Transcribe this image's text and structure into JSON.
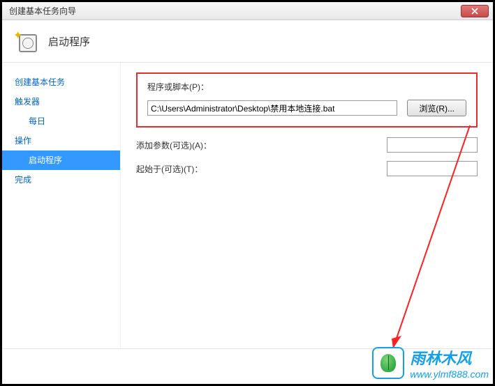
{
  "window": {
    "title": "创建基本任务向导"
  },
  "header": {
    "title": "启动程序"
  },
  "sidebar": {
    "items": [
      {
        "label": "创建基本任务"
      },
      {
        "label": "触发器"
      },
      {
        "label": "每日"
      },
      {
        "label": "操作"
      },
      {
        "label": "启动程序"
      },
      {
        "label": "完成"
      }
    ]
  },
  "form": {
    "script_label": "程序或脚本(P)：",
    "script_value": "C:\\Users\\Administrator\\Desktop\\禁用本地连接.bat",
    "browse_label": "浏览(R)...",
    "args_label": "添加参数(可选)(A)：",
    "args_value": "",
    "startin_label": "起始于(可选)(T)：",
    "startin_value": ""
  },
  "watermark": {
    "brand": "雨林木风",
    "url": "www.ylmf888.com"
  }
}
